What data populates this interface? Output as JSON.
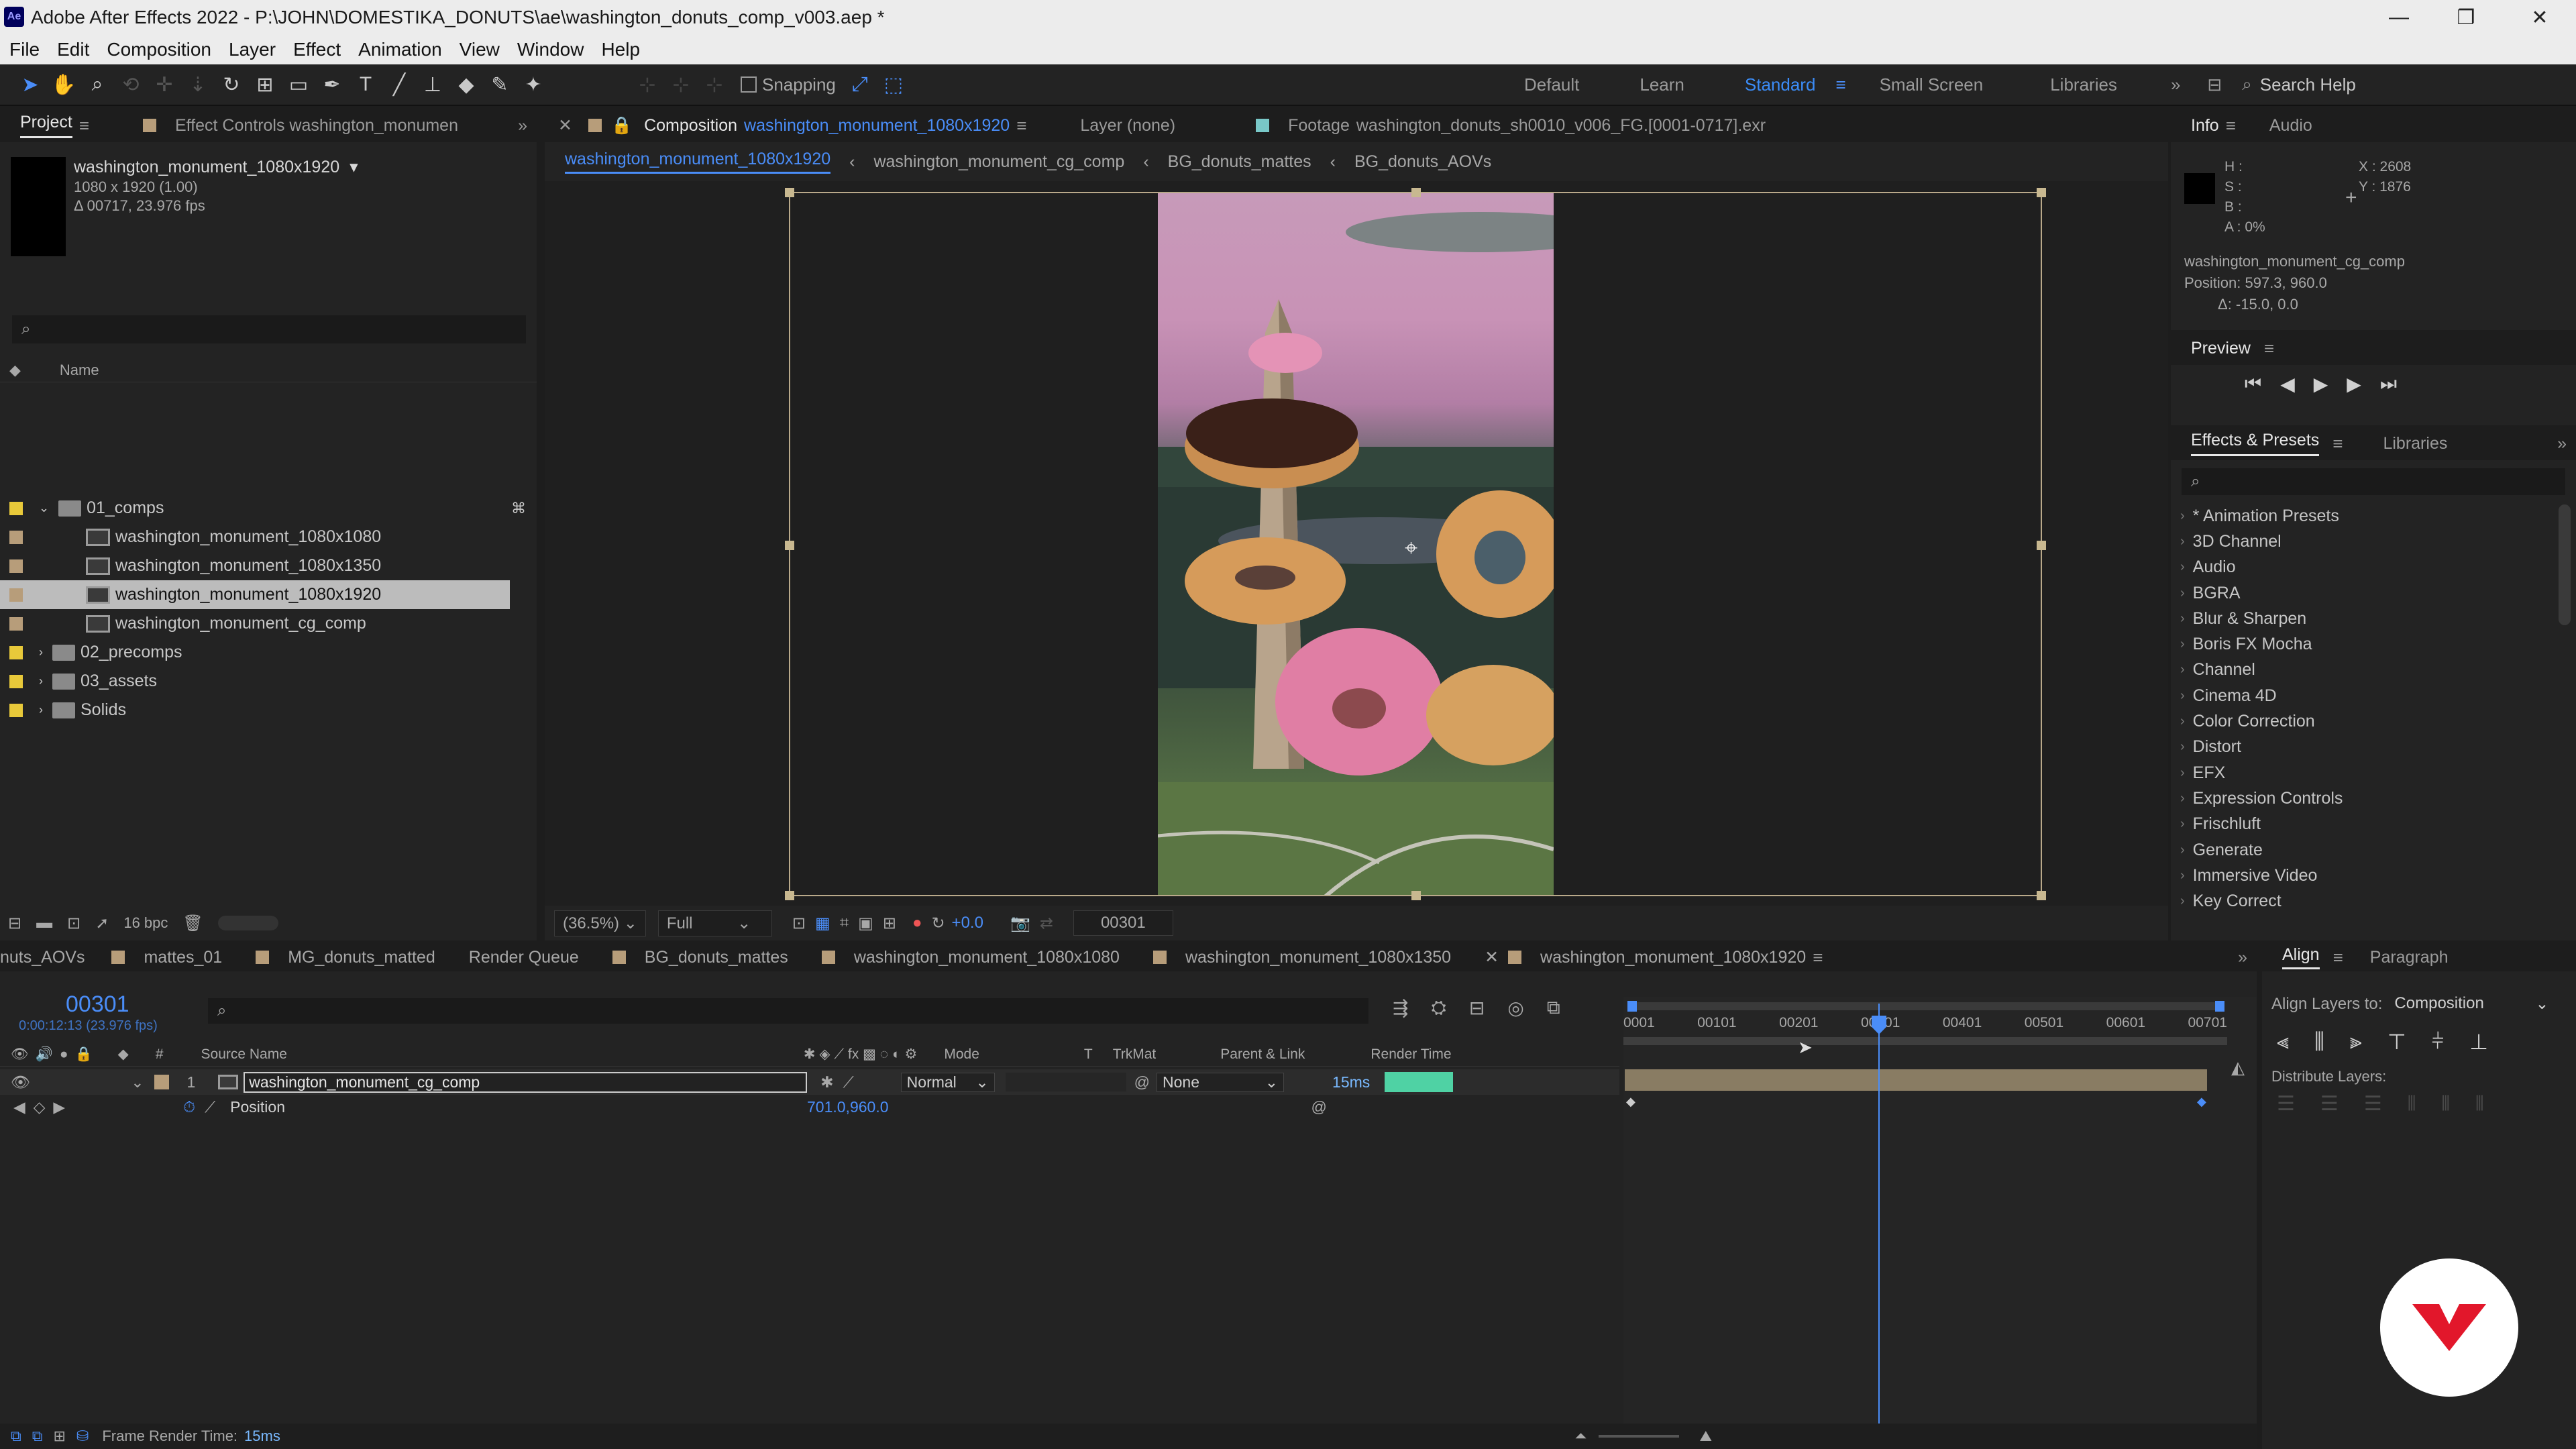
{
  "window": {
    "app_badge": "Ae",
    "title": "Adobe After Effects 2022 - P:\\JOHN\\DOMESTIKA_DONUTS\\ae\\washington_donuts_comp_v003.aep *",
    "minimize": "—",
    "maximize": "❐",
    "close": "✕"
  },
  "menu": [
    "File",
    "Edit",
    "Composition",
    "Layer",
    "Effect",
    "Animation",
    "View",
    "Window",
    "Help"
  ],
  "toolbar": {
    "snapping": "Snapping",
    "workspaces": [
      "Default",
      "Learn",
      "Standard",
      "Small Screen",
      "Libraries"
    ],
    "active_workspace": "Standard",
    "search_placeholder": "Search Help"
  },
  "project": {
    "tab": "Project",
    "effect_controls_tab": "Effect Controls washington_monumen",
    "selected_name": "washington_monument_1080x1920",
    "selected_dims": "1080 x 1920 (1.00)",
    "selected_duration": "Δ 00717, 23.976 fps",
    "col_name": "Name",
    "items": [
      {
        "name": "01_comps",
        "type": "folder",
        "color": "#e8c93a",
        "expanded": true
      },
      {
        "name": "washington_monument_1080x1080",
        "type": "comp",
        "color": "#b79d7a",
        "indent": 1
      },
      {
        "name": "washington_monument_1080x1350",
        "type": "comp",
        "color": "#b79d7a",
        "indent": 1
      },
      {
        "name": "washington_monument_1080x1920",
        "type": "comp",
        "color": "#b79d7a",
        "indent": 1,
        "selected": true
      },
      {
        "name": "washington_monument_cg_comp",
        "type": "comp",
        "color": "#b79d7a",
        "indent": 1
      },
      {
        "name": "02_precomps",
        "type": "folder",
        "color": "#e8c93a"
      },
      {
        "name": "03_assets",
        "type": "folder",
        "color": "#e8c93a"
      },
      {
        "name": "Solids",
        "type": "folder",
        "color": "#e8c93a"
      }
    ],
    "bpc": "16 bpc"
  },
  "viewer": {
    "comp_label": "Composition",
    "comp_name": "washington_monument_1080x1920",
    "layer_tab": "Layer (none)",
    "footage_label": "Footage",
    "footage_name": "washington_donuts_sh0010_v006_FG.[0001-0717].exr",
    "breadcrumbs": [
      "washington_monument_1080x1920",
      "washington_monument_cg_comp",
      "BG_donuts_mattes",
      "BG_donuts_AOVs"
    ],
    "zoom": "(36.5%)",
    "resolution": "Full",
    "exposure": "+0.0",
    "frame": "00301"
  },
  "info": {
    "tab": "Info",
    "audio_tab": "Audio",
    "h": "H :",
    "s": "S :",
    "b": "B :",
    "a": "A :  0%",
    "x": "X : 2608",
    "y": "Y : 1876",
    "layer": "washington_monument_cg_comp",
    "position": "Position: 597.3, 960.0",
    "delta": "Δ: -15.0, 0.0"
  },
  "preview": {
    "tab": "Preview"
  },
  "effects": {
    "tab": "Effects & Presets",
    "libraries_tab": "Libraries",
    "items": [
      "* Animation Presets",
      "3D Channel",
      "Audio",
      "BGRA",
      "Blur & Sharpen",
      "Boris FX Mocha",
      "Channel",
      "Cinema 4D",
      "Color Correction",
      "Distort",
      "EFX",
      "Expression Controls",
      "Frischluft",
      "Generate",
      "Immersive Video",
      "Key Correct"
    ]
  },
  "timeline": {
    "tabs": [
      {
        "label": "nuts_AOVs",
        "color": ""
      },
      {
        "label": "mattes_01",
        "color": "#b79d7a"
      },
      {
        "label": "MG_donuts_matted",
        "color": "#b79d7a"
      },
      {
        "label": "Render Queue",
        "color": ""
      },
      {
        "label": "BG_donuts_mattes",
        "color": "#b79d7a"
      },
      {
        "label": "washington_monument_1080x1080",
        "color": "#b79d7a"
      },
      {
        "label": "washington_monument_1080x1350",
        "color": "#b79d7a"
      },
      {
        "label": "washington_monument_1080x1920",
        "color": "#b79d7a",
        "active": true
      }
    ],
    "timecode": "00301",
    "timecode_sub": "0:00:12:13 (23.976 fps)",
    "cols": {
      "num": "#",
      "source": "Source Name",
      "mode": "Mode",
      "t": "T",
      "trkmat": "TrkMat",
      "parent": "Parent & Link",
      "render": "Render Time"
    },
    "layer": {
      "index": "1",
      "name": "washington_monument_cg_comp",
      "mode": "Normal",
      "parent": "None",
      "render_time": "15ms"
    },
    "property": {
      "name": "Position",
      "value": "701.0,960.0"
    },
    "ruler": [
      "0001",
      "00101",
      "00201",
      "00301",
      "00401",
      "00501",
      "00601",
      "00701"
    ],
    "frame_render_label": "Frame Render Time:",
    "frame_render_value": "15ms"
  },
  "align": {
    "tab": "Align",
    "paragraph_tab": "Paragraph",
    "align_to_label": "Align Layers to:",
    "align_to_value": "Composition",
    "distribute_label": "Distribute Layers:"
  }
}
